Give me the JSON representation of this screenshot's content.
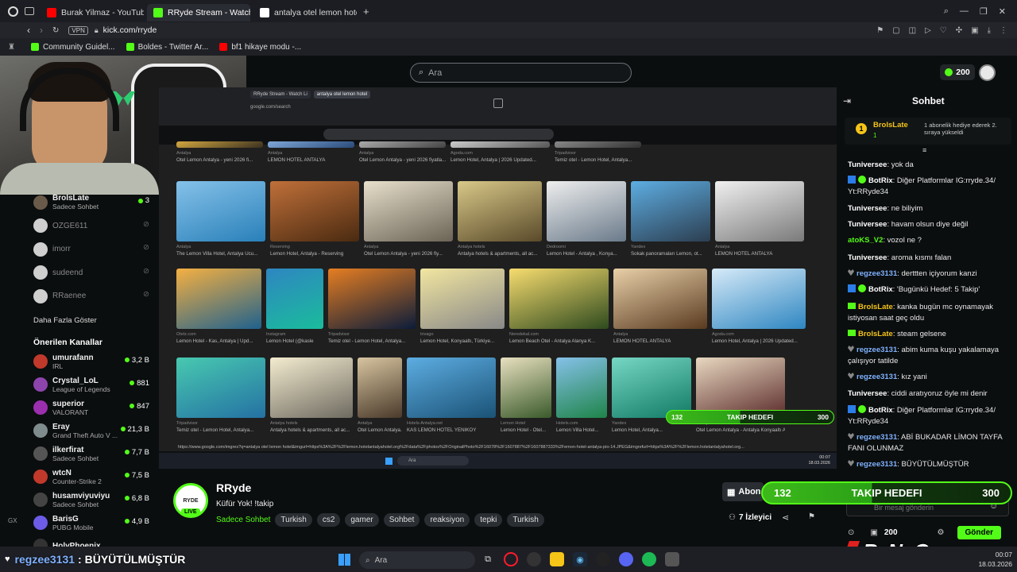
{
  "browser": {
    "tabs": [
      {
        "label": "Burak Yilmaz - YouTube",
        "color": "#ff0000"
      },
      {
        "label": "RRyde Stream - Watch Li",
        "color": "#53fc18"
      },
      {
        "label": "antalya otel lemon hotel -",
        "color": "#ffffff"
      }
    ],
    "new_tab": "+",
    "vpn": "VPN",
    "url": "kick.com/rryde",
    "bookmarks": [
      {
        "label": "Community Guidel...",
        "color": "#53fc18"
      },
      {
        "label": "Boldes - Twitter Ar...",
        "color": "#53fc18"
      },
      {
        "label": "bf1 hikaye modu -...",
        "color": "#ff0000"
      }
    ]
  },
  "kick": {
    "search_placeholder": "Ara",
    "points": "200",
    "sidebar": {
      "following": [
        {
          "name": "BrolsLate",
          "sub": "Sadece Sohbet",
          "count": "3",
          "live": true
        },
        {
          "name": "OZGE611",
          "sub": "",
          "count": "",
          "live": false
        },
        {
          "name": "imorr",
          "sub": "",
          "count": "",
          "live": false
        },
        {
          "name": "sudeend",
          "sub": "",
          "count": "",
          "live": false
        },
        {
          "name": "RRaenee",
          "sub": "",
          "count": "",
          "live": false
        }
      ],
      "show_more": "Daha Fazla Göster",
      "recommended_title": "Önerilen Kanallar",
      "recommended": [
        {
          "name": "umurafann",
          "sub": "IRL",
          "count": "3,2 B",
          "color": "#c0392b"
        },
        {
          "name": "Crystal_LoL",
          "sub": "League of Legends",
          "count": "881",
          "color": "#8e44ad"
        },
        {
          "name": "superior",
          "sub": "VALORANT",
          "count": "847",
          "color": "#9b2fae"
        },
        {
          "name": "Eray",
          "sub": "Grand Theft Auto V ...",
          "count": "21,3 B",
          "color": "#7f8c8d"
        },
        {
          "name": "ilkerfirat",
          "sub": "Sadece Sohbet",
          "count": "7,7 B",
          "color": "#555"
        },
        {
          "name": "wtcN",
          "sub": "Counter-Strike 2",
          "count": "7,5 B",
          "color": "#c0392b"
        },
        {
          "name": "husamviyuviyu",
          "sub": "Sadece Sohbet",
          "count": "6,8 B",
          "color": "#444"
        },
        {
          "name": "BarisG",
          "sub": "PUBG Mobile",
          "count": "4,9 B",
          "color": "#6c5ce7"
        },
        {
          "name": "HolyPhoenix",
          "sub": "",
          "count": "",
          "color": "#333"
        }
      ]
    },
    "channel": {
      "name": "RRyde",
      "title": "Küfür Yok! !takip",
      "category": "Sadece Sohbet",
      "tags": [
        "Turkish",
        "cs2",
        "gamer",
        "Sohbet",
        "reaksiyon",
        "tepki",
        "Turkish"
      ],
      "avatar_text": "RYDE",
      "live_badge": "LIVE",
      "subscribe": "Abon",
      "viewers": "7 İzleyici"
    },
    "chat": {
      "title": "Sohbet",
      "pinned_user": "BrolsLate",
      "pinned_rank": "1",
      "pinned_count": "1",
      "pinned_text": "1 abonelik hediye ederek 2. sıraya yükseldi",
      "messages": [
        {
          "user": "Tuniversee",
          "color": "#ffffff",
          "text": "yok da",
          "bot": false
        },
        {
          "user": "BotRix",
          "color": "#ffffff",
          "text": "Diğer Platformlar IG:rryde.34/ Yt:RRyde34",
          "bot": true
        },
        {
          "user": "Tuniversee",
          "color": "#ffffff",
          "text": "ne biliyim",
          "bot": false
        },
        {
          "user": "Tuniversee",
          "color": "#ffffff",
          "text": "havam olsun diye değil",
          "bot": false
        },
        {
          "user": "atoKS_V2",
          "color": "#53fc18",
          "text": "vozol ne ?",
          "bot": false
        },
        {
          "user": "Tuniversee",
          "color": "#ffffff",
          "text": "aroma kısmı falan",
          "bot": false
        },
        {
          "user": "regzee3131",
          "color": "#7fb2ff",
          "text": "derttten içiyorum kanzi",
          "bot": false
        },
        {
          "user": "BotRix",
          "color": "#ffffff",
          "text": "'Bugünkü Hedef: 5 Takip'",
          "bot": true
        },
        {
          "user": "BrolsLate",
          "color": "#f5c518",
          "text": "kanka bugün mc oynamayak istiyosan saat geç oldu",
          "bot": false
        },
        {
          "user": "BrolsLate",
          "color": "#f5c518",
          "text": "steam gelsene",
          "bot": false
        },
        {
          "user": "regzee3131",
          "color": "#7fb2ff",
          "text": "abim kuma kuşu yakalamaya çalışıyor tatilde",
          "bot": false
        },
        {
          "user": "regzee3131",
          "color": "#7fb2ff",
          "text": "kız yani",
          "bot": false
        },
        {
          "user": "Tuniversee",
          "color": "#ffffff",
          "text": "ciddi aratıyoruz öyle mi denir",
          "bot": false
        },
        {
          "user": "BotRix",
          "color": "#ffffff",
          "text": "Diğer Platformlar IG:rryde.34/ Yt:RRyde34",
          "bot": true
        },
        {
          "user": "regzee3131",
          "color": "#7fb2ff",
          "text": "ABİ BUKADAR LİMON TAYFA FANI OLUNMAZ",
          "bot": false
        },
        {
          "user": "regzee3131",
          "color": "#7fb2ff",
          "text": "BÜYÜTÜLMÜŞTÜR",
          "bot": false
        }
      ],
      "input_placeholder": "Bir mesaj gönderin",
      "send": "Gönder",
      "points": "200"
    }
  },
  "stream": {
    "search_query_tabs": [
      "RRyde Stream - Watch Li",
      "antalya otel lemon hotel"
    ],
    "inner_url": "google.com/search",
    "rows": [
      [
        {
          "cap": "Otel Lemon Antalya - yeni 2026 fi...",
          "src": "Antalya",
          "w": 109,
          "c1": "#3a3020",
          "c2": "#d4a840"
        },
        {
          "cap": "LEMON HOTEL ANTALYA",
          "src": "Antalya",
          "w": 109,
          "c1": "#2a4a7a",
          "c2": "#7fa8d8"
        },
        {
          "cap": "Otel Lemon Antalya - yeni 2026 fiyatla...",
          "src": "Antalya",
          "w": 109,
          "c1": "#444",
          "c2": "#aaa"
        },
        {
          "cap": "Lemon Hotel, Antalya | 2026 Updated...",
          "src": "Agoda.com",
          "w": 125,
          "c1": "#555",
          "c2": "#ccc"
        },
        {
          "cap": "Temiz otel - Lemon Hotel, Antalya...",
          "src": "Tripadvisor",
          "w": 109,
          "c1": "#333",
          "c2": "#888"
        }
      ],
      [
        {
          "cap": "The Lemon Villa Hotel, Antalya Ucu...",
          "src": "Antalya",
          "w": 112,
          "c1": "#2980b9",
          "c2": "#85c1e9"
        },
        {
          "cap": "Lemon Hotel, Antalya - Reserving",
          "src": "Reserving",
          "w": 112,
          "c1": "#4a2a10",
          "c2": "#c0703a"
        },
        {
          "cap": "Otel Lemon Antalya - yeni 2026 fiy...",
          "src": "Antalya",
          "w": 112,
          "c1": "#6b6355",
          "c2": "#e8e0cc"
        },
        {
          "cap": "Antalya hotels & apartments, all ac...",
          "src": "Antalya hotels",
          "w": 106,
          "c1": "#5a4a2a",
          "c2": "#d8c888"
        },
        {
          "cap": "Lemon Hotel - Antalya , Konya...",
          "src": "Dedroomi",
          "w": 100,
          "c1": "#6a7a8a",
          "c2": "#eee"
        },
        {
          "cap": "Sokak panoramaları Lemon, ot...",
          "src": "Yandex",
          "w": 100,
          "c1": "#2c3e50",
          "c2": "#5dade2"
        },
        {
          "cap": "LEMON HOTEL ANTALYA",
          "src": "Antalya",
          "w": 112,
          "c1": "#7a7a7a",
          "c2": "#f0f0f0"
        }
      ],
      [
        {
          "cap": "Lemon Hotel - Kas, Antalya | Upd...",
          "src": "Otelz.com",
          "w": 107,
          "c1": "#1f618d",
          "c2": "#f5b041"
        },
        {
          "cap": "Lemon Hotel (@kasle",
          "src": "Instagram",
          "w": 72,
          "c1": "#1abc9c",
          "c2": "#2e86c1"
        },
        {
          "cap": "Temiz otel - Lemon Hotel, Antalya...",
          "src": "Tripadvisor",
          "w": 110,
          "c1": "#0b1c3a",
          "c2": "#e67e22"
        },
        {
          "cap": "Lemon Hotel, Konyaaltı, Türkiye...",
          "src": "trivago",
          "w": 106,
          "c1": "#888",
          "c2": "#f2e6a0"
        },
        {
          "cap": "Lemon Beach Otel - Antalya Alanya K...",
          "src": "Neredekal.com",
          "w": 125,
          "c1": "#2e4a1e",
          "c2": "#f7dc6f"
        },
        {
          "cap": "LEMON HOTEL ANTALYA",
          "src": "Antalya",
          "w": 118,
          "c1": "#5a3a20",
          "c2": "#e8d0a8"
        },
        {
          "cap": "Lemon Hotel, Antalya | 2026 Updated...",
          "src": "Agoda.com",
          "w": 118,
          "c1": "#2e86c1",
          "c2": "#d6eaf8"
        }
      ],
      [
        {
          "cap": "Temiz otel - Lemon Hotel, Antalya...",
          "src": "Tripadvisor",
          "w": 112,
          "c1": "#2471a3",
          "c2": "#48c9b0"
        },
        {
          "cap": "Antalya hotels & apartments, all ac...",
          "src": "Antalya hotels",
          "w": 104,
          "c1": "#6e6a60",
          "c2": "#f4ecd0"
        },
        {
          "cap": "Otel Lemon Antalya...",
          "src": "Antalya",
          "w": 56,
          "c1": "#4a3a2a",
          "c2": "#d7c4a0"
        },
        {
          "cap": "KAS LEMON HOTEL YENIKOY",
          "src": "Hotels-Antalya.net",
          "w": 112,
          "c1": "#1a5276",
          "c2": "#5dade2"
        },
        {
          "cap": "Lemon Hotel - Otel...",
          "src": "Lemon Hotel",
          "w": 64,
          "c1": "#3a5a2a",
          "c2": "#e8e0c0"
        },
        {
          "cap": "Lemon Villa Hotel...",
          "src": "Hotels.com",
          "w": 64,
          "c1": "#1e8449",
          "c2": "#85c1e9"
        },
        {
          "cap": "Lemon Hotel, Antalya...",
          "src": "Yandex",
          "w": 100,
          "c1": "#117a65",
          "c2": "#76d7c4"
        },
        {
          "cap": "Otel Lemon Antalya - Antalya Konyaaltı A...",
          "src": "Antalya",
          "w": 112,
          "c1": "#5a2a2a",
          "c2": "#e8d8c0"
        }
      ]
    ],
    "status_url": "https://www.google.com/imgres?q=antalya otel lemon hotel&imgurl=https%3A%2F%2Flemon.hotelantalyahotel.org%2Fdata%2Fphotos%2FOriginalPhoto%2F16078%2F1607887%2F1607887333%2Femon-hotel-antalya-pio-14.JPEG&imgrefurl=https%3A%2F%2Flemon.hotelantalyahotel.org...",
    "inner_taskbar_search": "Ara",
    "inner_time": "00:07",
    "inner_date": "18.03.2026"
  },
  "goal": {
    "current": "132",
    "label": "TAKIP HEDEFI",
    "target": "300",
    "progress": 0.44
  },
  "overlay": {
    "bottom_user": "regzee3131",
    "bottom_text": ": BÜYÜTÜLMÜŞTÜR",
    "brand": "ByNoGame"
  },
  "taskbar": {
    "search": "Ara",
    "time": "00:07",
    "date": "18.03.2026"
  }
}
